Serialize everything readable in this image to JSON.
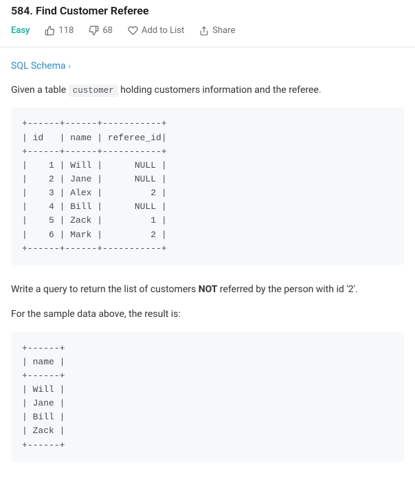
{
  "problem": {
    "number": "584.",
    "title": "Find Customer Referee",
    "difficulty": "Easy",
    "likes": "118",
    "dislikes": "68",
    "add_to_list": "Add to List",
    "share": "Share"
  },
  "schema_link": "SQL Schema",
  "description": {
    "intro_prefix": "Given a table ",
    "table_name": "customer",
    "intro_suffix": " holding customers information and the referee."
  },
  "table_block": "+------+------+-----------+\n| id   | name | referee_id|\n+------+------+-----------+\n|    1 | Will |      NULL |\n|    2 | Jane |      NULL |\n|    3 | Alex |         2 |\n|    4 | Bill |      NULL |\n|    5 | Zack |         1 |\n|    6 | Mark |         2 |\n+------+------+-----------+",
  "task": {
    "prefix": "Write a query to return the list of customers ",
    "emph": "NOT",
    "suffix": " referred by the person with id '2'."
  },
  "result_intro": "For the sample data above, the result is:",
  "result_block": "+------+\n| name |\n+------+\n| Will |\n| Jane |\n| Bill |\n| Zack |\n+------+",
  "chart_data": {
    "type": "table",
    "title": "customer",
    "columns": [
      "id",
      "name",
      "referee_id"
    ],
    "rows": [
      [
        1,
        "Will",
        null
      ],
      [
        2,
        "Jane",
        null
      ],
      [
        3,
        "Alex",
        2
      ],
      [
        4,
        "Bill",
        null
      ],
      [
        5,
        "Zack",
        1
      ],
      [
        6,
        "Mark",
        2
      ]
    ],
    "expected_result": {
      "columns": [
        "name"
      ],
      "rows": [
        [
          "Will"
        ],
        [
          "Jane"
        ],
        [
          "Bill"
        ],
        [
          "Zack"
        ]
      ]
    }
  }
}
